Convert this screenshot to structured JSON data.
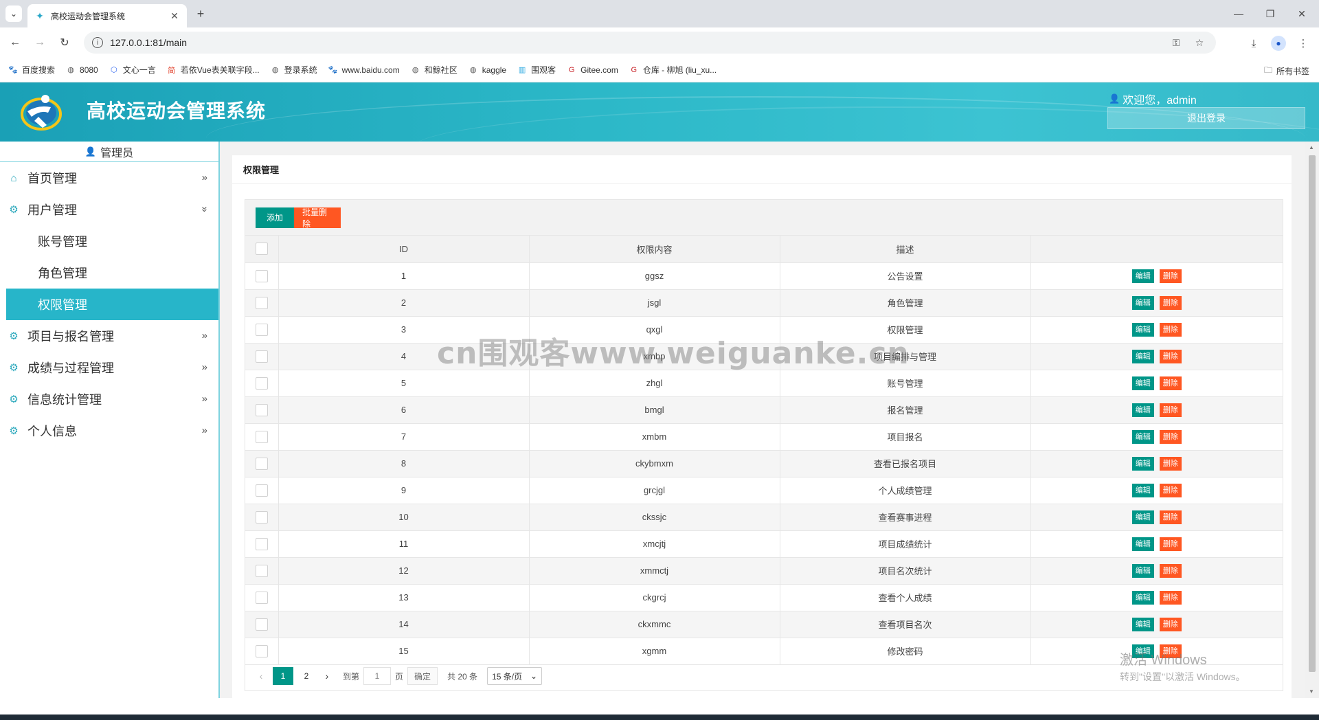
{
  "browser": {
    "tab_title": "高校运动会管理系统",
    "url": "127.0.0.1:81/main",
    "bookmarks": [
      {
        "label": "百度搜索",
        "icon": "paw-icon",
        "color": "#2932e1"
      },
      {
        "label": "8080",
        "icon": "globe-icon",
        "color": "#555555"
      },
      {
        "label": "文心一言",
        "icon": "cube-icon",
        "color": "#3a6df0"
      },
      {
        "label": "若依Vue表关联字段...",
        "icon": "jian-icon",
        "color": "#e2442f"
      },
      {
        "label": "登录系统",
        "icon": "globe-icon",
        "color": "#555555"
      },
      {
        "label": "www.baidu.com",
        "icon": "paw-icon",
        "color": "#2932e1"
      },
      {
        "label": "和鲸社区",
        "icon": "globe-icon",
        "color": "#555555"
      },
      {
        "label": "kaggle",
        "icon": "globe-icon",
        "color": "#555555"
      },
      {
        "label": "围观客",
        "icon": "bars-icon",
        "color": "#2aa8e0"
      },
      {
        "label": "Gitee.com",
        "icon": "gitee-icon",
        "color": "#c71d23"
      },
      {
        "label": "仓库 - 柳旭 (liu_xu...",
        "icon": "gitee-icon",
        "color": "#c71d23"
      }
    ],
    "all_bookmarks": "所有书签"
  },
  "header": {
    "title": "高校运动会管理系统",
    "welcome": "欢迎您，admin",
    "logout": "退出登录"
  },
  "sidebar": {
    "role": "管理员",
    "menu": {
      "home": "首页管理",
      "user": "用户管理",
      "account": "账号管理",
      "role": "角色管理",
      "permission": "权限管理",
      "project": "项目与报名管理",
      "score": "成绩与过程管理",
      "stats": "信息统计管理",
      "personal": "个人信息"
    }
  },
  "main": {
    "card_title": "权限管理",
    "add": "添加",
    "batch_delete": "批量删除",
    "columns": [
      "ID",
      "权限内容",
      "描述",
      ""
    ],
    "edit": "编辑",
    "delete": "删除",
    "rows": [
      {
        "id": "1",
        "content": "ggsz",
        "desc": "公告设置"
      },
      {
        "id": "2",
        "content": "jsgl",
        "desc": "角色管理"
      },
      {
        "id": "3",
        "content": "qxgl",
        "desc": "权限管理"
      },
      {
        "id": "4",
        "content": "xmbp",
        "desc": "项目编排与管理"
      },
      {
        "id": "5",
        "content": "zhgl",
        "desc": "账号管理"
      },
      {
        "id": "6",
        "content": "bmgl",
        "desc": "报名管理"
      },
      {
        "id": "7",
        "content": "xmbm",
        "desc": "项目报名"
      },
      {
        "id": "8",
        "content": "ckybmxm",
        "desc": "查看已报名项目"
      },
      {
        "id": "9",
        "content": "grcjgl",
        "desc": "个人成绩管理"
      },
      {
        "id": "10",
        "content": "ckssjc",
        "desc": "查看赛事进程"
      },
      {
        "id": "11",
        "content": "xmcjtj",
        "desc": "项目成绩统计"
      },
      {
        "id": "12",
        "content": "xmmctj",
        "desc": "项目名次统计"
      },
      {
        "id": "13",
        "content": "ckgrcj",
        "desc": "查看个人成绩"
      },
      {
        "id": "14",
        "content": "ckxmmc",
        "desc": "查看项目名次"
      },
      {
        "id": "15",
        "content": "xgmm",
        "desc": "修改密码"
      }
    ],
    "pager": {
      "page1": "1",
      "page2": "2",
      "goto": "到第",
      "goto_value": "1",
      "page_unit": "页",
      "confirm": "确定",
      "total": "共 20 条",
      "per_page": "15 条/页"
    }
  },
  "overlay": {
    "watermark": "cn围观客www.weiguanke.cn",
    "activate_title": "激活 Windows",
    "activate_hint": "转到\"设置\"以激活 Windows。"
  },
  "colors": {
    "header_teal": "#2cb8c8",
    "active_menu": "#27b5c9",
    "primary_green": "#009688",
    "danger_orange": "#ff5722"
  }
}
